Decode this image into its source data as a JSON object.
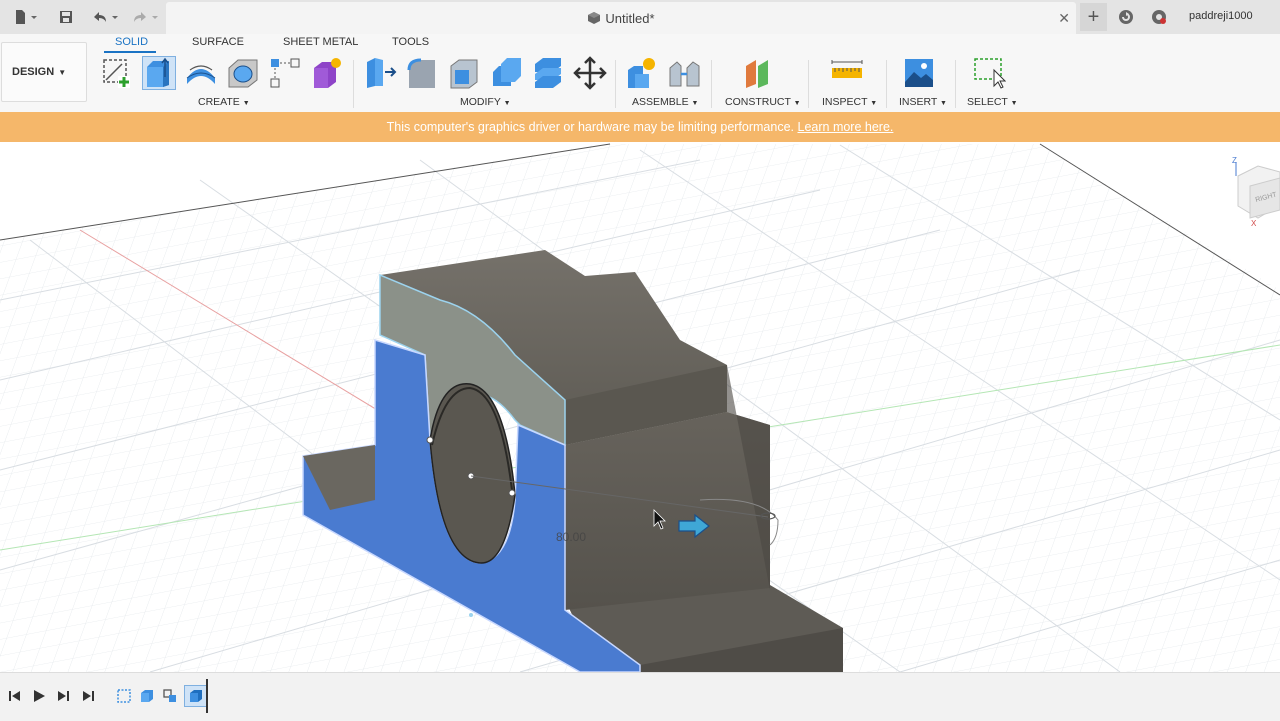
{
  "titlebar": {
    "document_title": "Untitled*",
    "user_name": "paddreji1000",
    "icons": [
      "file-icon",
      "save-icon",
      "undo-icon",
      "redo-icon",
      "document-icon",
      "close-icon",
      "plus-icon",
      "refresh-icon",
      "help-icon"
    ]
  },
  "toolbar": {
    "workspace_button": "DESIGN",
    "tabs": [
      "SOLID",
      "SURFACE",
      "SHEET METAL",
      "TOOLS"
    ],
    "active_tab": "SOLID",
    "groups": {
      "create": "CREATE",
      "modify": "MODIFY",
      "assemble": "ASSEMBLE",
      "construct": "CONSTRUCT",
      "inspect": "INSPECT",
      "insert": "INSERT",
      "select": "SELECT"
    },
    "accent_color": "#1a73c4"
  },
  "warning": {
    "message": "This computer's graphics driver or hardware may be limiting performance.",
    "link": "Learn more here.",
    "color": "#f5b76a"
  },
  "viewport": {
    "dimension_value": "80.00",
    "viewcube_face": "RIGHT",
    "axis_labels": {
      "z": "Z",
      "x": "X"
    },
    "body_color": "#6e6a62",
    "selected_face_color": "#4a7bd0"
  },
  "timeline": {
    "controls": [
      "step-back-icon",
      "play-icon",
      "step-forward-icon",
      "go-to-end-icon"
    ],
    "features": [
      "sketch-feature-icon",
      "extrude-feature-icon",
      "sketch-feature-icon-2",
      "extrude-feature-icon-active"
    ]
  }
}
